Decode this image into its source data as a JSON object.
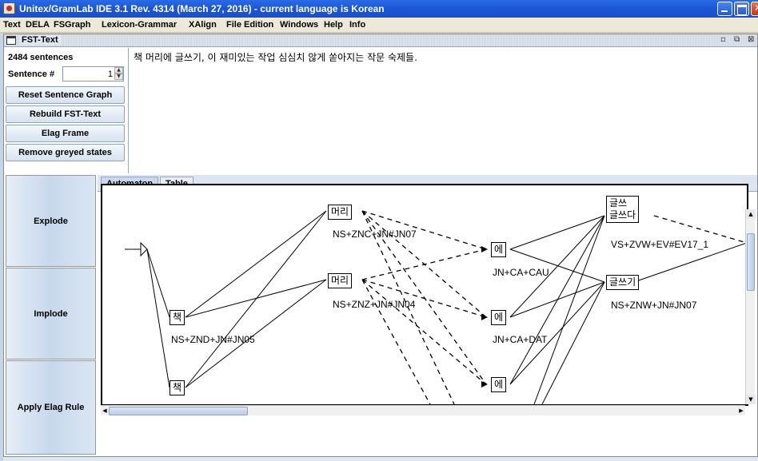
{
  "window": {
    "title": "Unitex/GramLab IDE 3.1  Rev. 4314 (March 27, 2016) - current language is Korean"
  },
  "menu": {
    "items": [
      "Text",
      "DELA",
      "FSGraph",
      "Lexicon-Grammar",
      "XAlign",
      "File Edition",
      "Windows",
      "Help",
      "Info"
    ]
  },
  "frame": {
    "title": "FST-Text"
  },
  "controls": {
    "sentence_count": "2484 sentences",
    "sentence_label": "Sentence #",
    "sentence_number": "1",
    "buttons": [
      "Reset Sentence Graph",
      "Rebuild FST-Text",
      "Elag Frame",
      "Remove greyed states"
    ]
  },
  "sentence_text": "책 머리에 글쓰기, 이 재미있는 작업 심심치 않게 쏟아지는 작문 숙제들.",
  "side_buttons": [
    "Explode",
    "Implode",
    "Apply Elag Rule"
  ],
  "tabs": [
    "Automaton",
    "Table"
  ],
  "graph": {
    "boxes": [
      {
        "id": "b1",
        "text": "머리"
      },
      {
        "id": "b2",
        "text": "머리"
      },
      {
        "id": "b3",
        "text": "책"
      },
      {
        "id": "b4",
        "text": "책"
      },
      {
        "id": "b5",
        "text": "에"
      },
      {
        "id": "b6",
        "text": "에"
      },
      {
        "id": "b7",
        "text": "에"
      },
      {
        "id": "b8a",
        "text": "글쓰"
      },
      {
        "id": "b8b",
        "text": "글쓰다"
      },
      {
        "id": "b9",
        "text": "글쓰기"
      }
    ],
    "labels": {
      "l1": "NS+ZNC+JN#JN07",
      "l2": "NS+ZNZ+JN#JN04",
      "l3": "NS+ZND+JN#JN05",
      "l5": "JN+CA+CAU",
      "l6": "JN+CA+DAT",
      "l8": "VS+ZVW+EV#EV17_1",
      "l9": "NS+ZNW+JN#JN07"
    }
  }
}
